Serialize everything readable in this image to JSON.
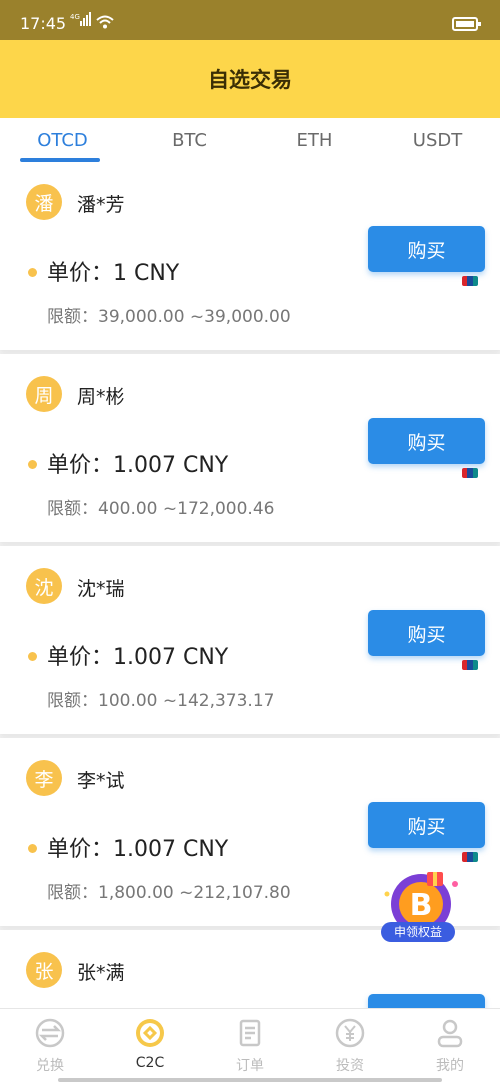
{
  "status": {
    "time": "17:45",
    "network": "4G"
  },
  "header": {
    "title": "自选交易"
  },
  "tabs": [
    {
      "label": "OTCD",
      "active": true
    },
    {
      "label": "BTC",
      "active": false
    },
    {
      "label": "ETH",
      "active": false
    },
    {
      "label": "USDT",
      "active": false
    }
  ],
  "listings": [
    {
      "avatar": "潘",
      "name": "潘*芳",
      "price": "单价：1 CNY",
      "limit": "限额：39,000.00 ~39,000.00",
      "button": "购买"
    },
    {
      "avatar": "周",
      "name": "周*彬",
      "price": "单价：1.007 CNY",
      "limit": "限额：400.00 ~172,000.46",
      "button": "购买"
    },
    {
      "avatar": "沈",
      "name": "沈*瑞",
      "price": "单价：1.007 CNY",
      "limit": "限额：100.00 ~142,373.17",
      "button": "购买"
    },
    {
      "avatar": "李",
      "name": "李*试",
      "price": "单价：1.007 CNY",
      "limit": "限额：1,800.00 ~212,107.80",
      "button": "购买"
    },
    {
      "avatar": "张",
      "name": "张*满",
      "price": "",
      "limit": "",
      "button": ""
    }
  ],
  "promo": {
    "label": "申领权益"
  },
  "bottom_nav": [
    {
      "label": "兑换",
      "icon": "exchange-icon",
      "active": false
    },
    {
      "label": "C2C",
      "icon": "c2c-icon",
      "active": true
    },
    {
      "label": "订单",
      "icon": "order-icon",
      "active": false
    },
    {
      "label": "投资",
      "icon": "invest-icon",
      "active": false
    },
    {
      "label": "我的",
      "icon": "profile-icon",
      "active": false
    }
  ],
  "colors": {
    "header_bg": "#fdd64a",
    "status_bg": "#9a812c",
    "accent_blue": "#2b8ce6",
    "avatar_bg": "#f8c24d"
  }
}
